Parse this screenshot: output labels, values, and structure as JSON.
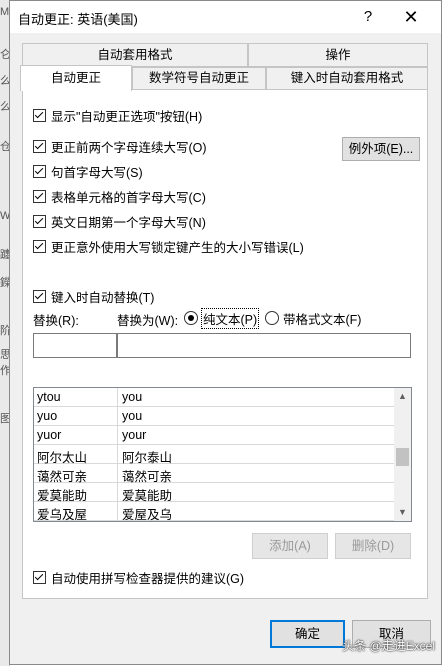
{
  "background_app": {
    "side_chars": [
      "M",
      "仑",
      "么",
      "么",
      "仓",
      "W",
      "躔",
      "鑅",
      "阶",
      "思",
      "作",
      "图"
    ]
  },
  "dialog": {
    "title": "自动更正: 英语(美国)",
    "help_label": "?",
    "close_label": "✕"
  },
  "tabs": {
    "top_row": [
      {
        "label": "自动套用格式"
      },
      {
        "label": "操作"
      }
    ],
    "bottom_row": [
      {
        "label": "自动更正",
        "active": true
      },
      {
        "label": "数学符号自动更正"
      },
      {
        "label": "键入时自动套用格式"
      }
    ]
  },
  "options": {
    "show_buttons": "显示\"自动更正选项\"按钮(H)",
    "two_initial_caps": "更正前两个字母连续大写(O)",
    "capitalize_sentence": "句首字母大写(S)",
    "capitalize_table_cells": "表格单元格的首字母大写(C)",
    "capitalize_days": "英文日期第一个字母大写(N)",
    "caps_lock": "更正意外使用大写锁定键产生的大小写错误(L)",
    "exceptions_button": "例外项(E)..."
  },
  "replace": {
    "replace_as_you_type": "键入时自动替换(T)",
    "replace_label": "替换(R):",
    "with_label": "替换为(W):",
    "plain_text": "纯文本(P)",
    "formatted_text": "带格式文本(F)",
    "replace_value": "",
    "with_value": "",
    "entries": [
      {
        "from": "ytou",
        "to": "you"
      },
      {
        "from": "yuo",
        "to": "you"
      },
      {
        "from": "yuor",
        "to": "your"
      },
      {
        "from": "阿尔太山",
        "to": "阿尔泰山"
      },
      {
        "from": "蔼然可亲",
        "to": "蔼然可亲"
      },
      {
        "from": "爱莫能助",
        "to": "爱莫能助"
      },
      {
        "from": "爱乌及屋",
        "to": "爱屋及乌"
      }
    ],
    "add_button": "添加(A)",
    "delete_button": "删除(D)",
    "spell_checker": "自动使用拼写检查器提供的建议(G)"
  },
  "footer": {
    "ok_button": "确定",
    "cancel_button": "取消"
  },
  "watermark": "头条 @走进Excel"
}
